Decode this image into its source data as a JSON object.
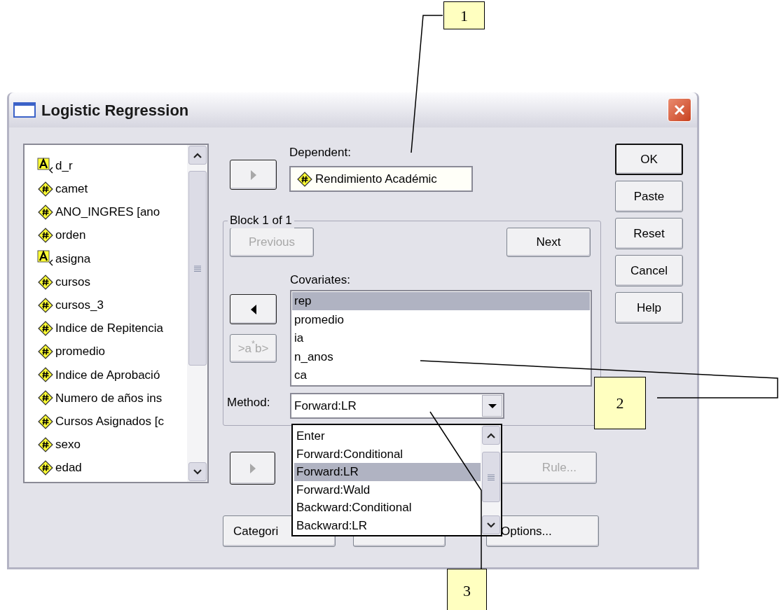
{
  "window": {
    "title": "Logistic Regression"
  },
  "variables": [
    {
      "name": "d_r",
      "kind": "string"
    },
    {
      "name": "camet",
      "kind": "numeric"
    },
    {
      "name": "ANO_INGRES [ano",
      "kind": "numeric"
    },
    {
      "name": "orden",
      "kind": "numeric"
    },
    {
      "name": "asigna",
      "kind": "string"
    },
    {
      "name": "cursos",
      "kind": "numeric"
    },
    {
      "name": "cursos_3",
      "kind": "numeric"
    },
    {
      "name": "Indice de Repitencia",
      "kind": "numeric"
    },
    {
      "name": "promedio",
      "kind": "numeric"
    },
    {
      "name": "Indice de Aprobació",
      "kind": "numeric"
    },
    {
      "name": "Numero de años ins",
      "kind": "numeric"
    },
    {
      "name": "Cursos Asignados [c",
      "kind": "numeric"
    },
    {
      "name": "sexo",
      "kind": "numeric"
    },
    {
      "name": "edad",
      "kind": "numeric"
    }
  ],
  "move_buttons": [
    {
      "kind": "right",
      "disabled": true
    },
    {
      "kind": "left",
      "disabled": false
    },
    {
      "kind": "right",
      "disabled": true
    }
  ],
  "dependent": {
    "label": "Dependent:",
    "value": "Rendimiento Académic",
    "kind": "numeric"
  },
  "block": {
    "title": "Block 1 of 1",
    "previous": {
      "label": "Previous",
      "disabled": true
    },
    "next": {
      "label": "Next",
      "disabled": false
    }
  },
  "covariates": {
    "label": "Covariates:",
    "items": [
      {
        "name": "rep",
        "selected": true
      },
      {
        "name": "promedio",
        "selected": false
      },
      {
        "name": "ia",
        "selected": false
      },
      {
        "name": "n_anos",
        "selected": false
      },
      {
        "name": "ca",
        "selected": false
      }
    ]
  },
  "interaction_button": {
    "label": ">a$^{*}$b>",
    "disabled": true
  },
  "method": {
    "label": "Method:",
    "value": "Forward:LR",
    "options": [
      {
        "label": "Enter",
        "selected": false
      },
      {
        "label": "Forward:Conditional",
        "selected": false
      },
      {
        "label": "Forward:LR",
        "selected": true
      },
      {
        "label": "Forward:Wald",
        "selected": false
      },
      {
        "label": "Backward:Conditional",
        "selected": false
      },
      {
        "label": "Backward:LR",
        "selected": false
      }
    ]
  },
  "rule_button": {
    "label": "Rule...",
    "disabled": true
  },
  "bottom_buttons": [
    {
      "kind": "labeled",
      "label": "Categori"
    },
    {
      "kind": "blank"
    },
    {
      "kind": "labeled",
      "label": "Options..."
    }
  ],
  "action_buttons": [
    {
      "label": "OK",
      "default": true
    },
    {
      "label": "Paste",
      "default": false
    },
    {
      "label": "Reset",
      "default": false
    },
    {
      "label": "Cancel",
      "default": false
    },
    {
      "label": "Help",
      "default": false
    }
  ],
  "callouts": [
    {
      "label": "1"
    },
    {
      "label": "2"
    },
    {
      "label": "3"
    }
  ]
}
